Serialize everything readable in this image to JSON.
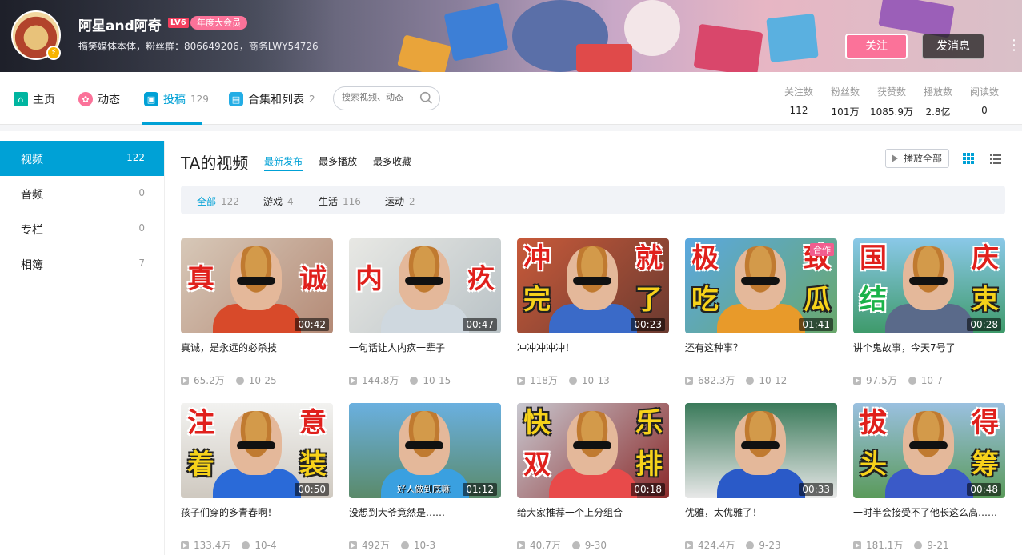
{
  "header": {
    "username": "阿星and阿奇",
    "level": "LV6",
    "vip_badge": "年度大会员",
    "sign": "搞笑媒体本体，粉丝群：806649206，商务LWY54726",
    "follow_label": "关注",
    "message_label": "发消息",
    "more_label": "⋮"
  },
  "nav": {
    "items": [
      {
        "label": "主页",
        "count": ""
      },
      {
        "label": "动态",
        "count": ""
      },
      {
        "label": "投稿",
        "count": "129"
      },
      {
        "label": "合集和列表",
        "count": "2"
      }
    ],
    "search_placeholder": "搜索视频、动态"
  },
  "stats": [
    {
      "label": "关注数",
      "value": "112"
    },
    {
      "label": "粉丝数",
      "value": "101万"
    },
    {
      "label": "获赞数",
      "value": "1085.9万"
    },
    {
      "label": "播放数",
      "value": "2.8亿"
    },
    {
      "label": "阅读数",
      "value": "0"
    }
  ],
  "sidebar": {
    "items": [
      {
        "label": "视频",
        "count": "122"
      },
      {
        "label": "音频",
        "count": "0"
      },
      {
        "label": "专栏",
        "count": "0"
      },
      {
        "label": "相簿",
        "count": "7"
      }
    ]
  },
  "main": {
    "title": "TA的视频",
    "sort": [
      "最新发布",
      "最多播放",
      "最多收藏"
    ],
    "play_all": "播放全部",
    "filters": [
      {
        "label": "全部",
        "count": "122"
      },
      {
        "label": "游戏",
        "count": "4"
      },
      {
        "label": "生活",
        "count": "116"
      },
      {
        "label": "运动",
        "count": "2"
      }
    ]
  },
  "videos": [
    {
      "title": "真诚，是永远的必杀技",
      "duration": "00:42",
      "plays": "65.2万",
      "date": "10-25",
      "caps": [
        "真",
        "诚"
      ]
    },
    {
      "title": "一句话让人内疚一辈子",
      "duration": "00:47",
      "plays": "144.8万",
      "date": "10-15",
      "caps": [
        "内",
        "疚"
      ]
    },
    {
      "title": "冲冲冲冲冲！",
      "duration": "00:23",
      "plays": "118万",
      "date": "10-13",
      "caps": [
        "冲",
        "就",
        "完",
        "了"
      ]
    },
    {
      "title": "还有这种事？",
      "duration": "01:41",
      "plays": "682.3万",
      "date": "10-12",
      "caps": [
        "极",
        "致",
        "吃",
        "瓜"
      ],
      "tag": "合作"
    },
    {
      "title": "讲个鬼故事，今天7号了",
      "duration": "00:28",
      "plays": "97.5万",
      "date": "10-7",
      "caps": [
        "国",
        "庆",
        "结",
        "束"
      ]
    },
    {
      "title": "孩子们穿的多青春啊！",
      "duration": "00:50",
      "plays": "133.4万",
      "date": "10-4",
      "caps": [
        "注",
        "意",
        "着",
        "装"
      ]
    },
    {
      "title": "没想到大爷竟然是……",
      "duration": "01:12",
      "plays": "492万",
      "date": "10-3",
      "caps": [],
      "sub": "好人做到底嘛"
    },
    {
      "title": "给大家推荐一个上分组合",
      "duration": "00:18",
      "plays": "40.7万",
      "date": "9-30",
      "caps": [
        "快",
        "乐",
        "双",
        "排"
      ]
    },
    {
      "title": "优雅，太优雅了！",
      "duration": "00:33",
      "plays": "424.4万",
      "date": "9-23",
      "caps": []
    },
    {
      "title": "一时半会接受不了他长这么高……",
      "duration": "00:48",
      "plays": "181.1万",
      "date": "9-21",
      "caps": [
        "拔",
        "得",
        "头",
        "筹"
      ]
    }
  ],
  "colors": {
    "accent": "#00a1d6",
    "pink": "#fb7299"
  }
}
